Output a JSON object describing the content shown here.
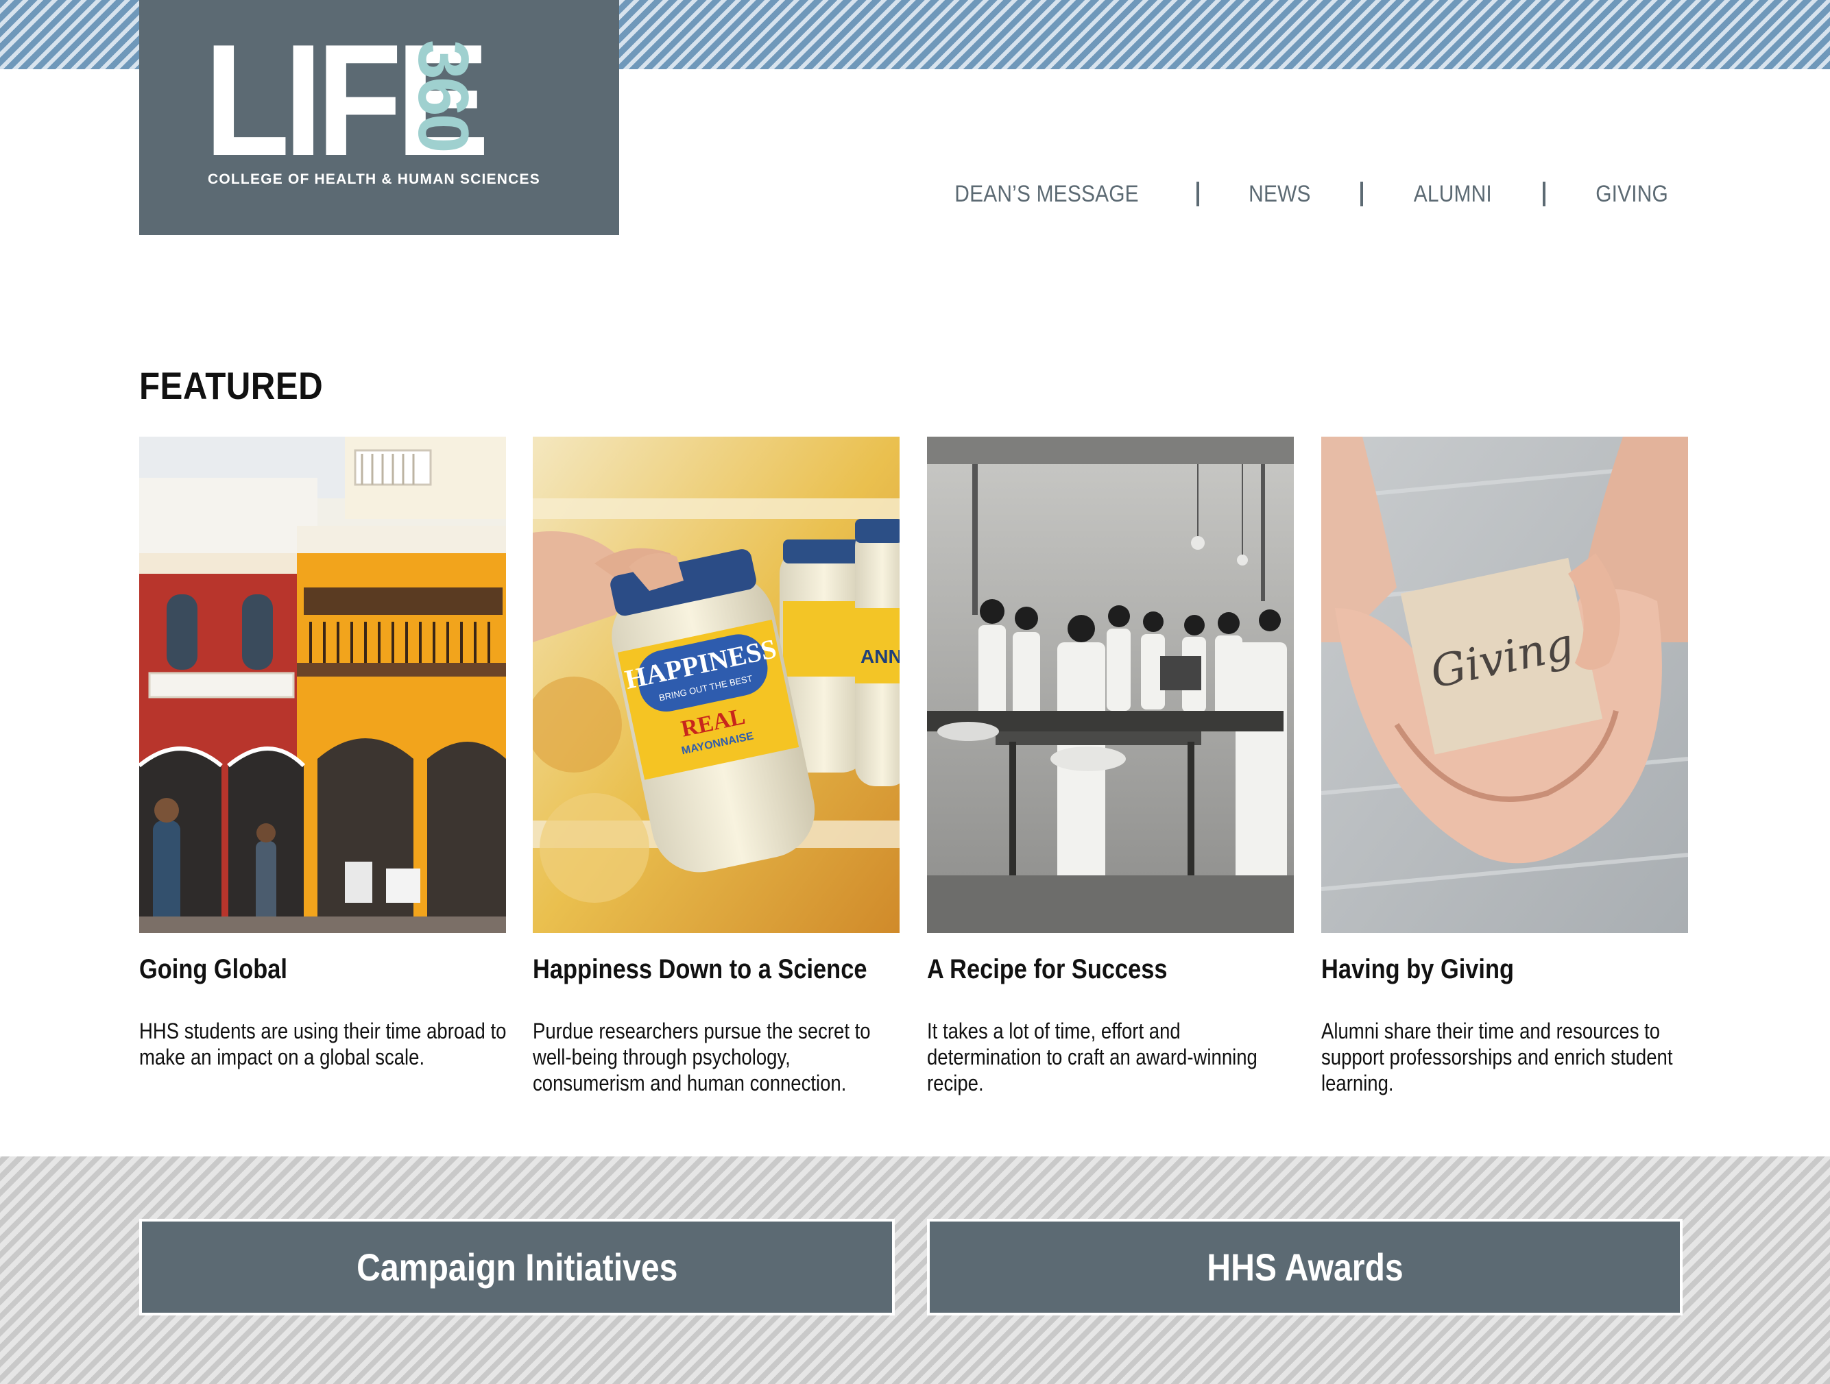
{
  "header": {
    "logo": {
      "word": "LIFE",
      "number": "360",
      "subtitle": "COLLEGE OF HEALTH & HUMAN SCIENCES"
    },
    "nav": [
      {
        "label": "DEAN’S MESSAGE"
      },
      {
        "label": "NEWS"
      },
      {
        "label": "ALUMNI"
      },
      {
        "label": "GIVING"
      }
    ]
  },
  "featured": {
    "title": "FEATURED",
    "cards": [
      {
        "title": "Going Global",
        "text": "HHS students are using their time abroad to make an impact on a global scale.",
        "image": "colorful-colonial-buildings-street"
      },
      {
        "title": "Happiness Down to a Science",
        "text": "Purdue researchers pursue the secret to well-being through psychology, consumerism and human connection.",
        "image": "hand-grabbing-mayonnaise-jar",
        "image_text": {
          "brand": "HAPPINESS",
          "tagline": "BRING OUT THE BEST",
          "product": "REAL",
          "product_sub": "MAYONNAISE",
          "background_jar": "ANN'S"
        }
      },
      {
        "title": "A Recipe for Success",
        "text": "It takes a lot of time, effort and determination to craft an award-winning recipe.",
        "image": "vintage-cooking-class-photo"
      },
      {
        "title": "Having by Giving",
        "text": "Alumni share their time and resources to support professorships and enrich student learning.",
        "image": "hands-holding-giving-card",
        "image_text": {
          "card_word": "Giving"
        }
      }
    ]
  },
  "cta": {
    "left_label": "Campaign Initiatives",
    "right_label": "HHS Awards"
  },
  "colors": {
    "slate": "#5c6a73",
    "teal": "#9fd0cf",
    "stripe_blue": "#6f98ba",
    "stripe_gray": "#c9c9c9"
  }
}
